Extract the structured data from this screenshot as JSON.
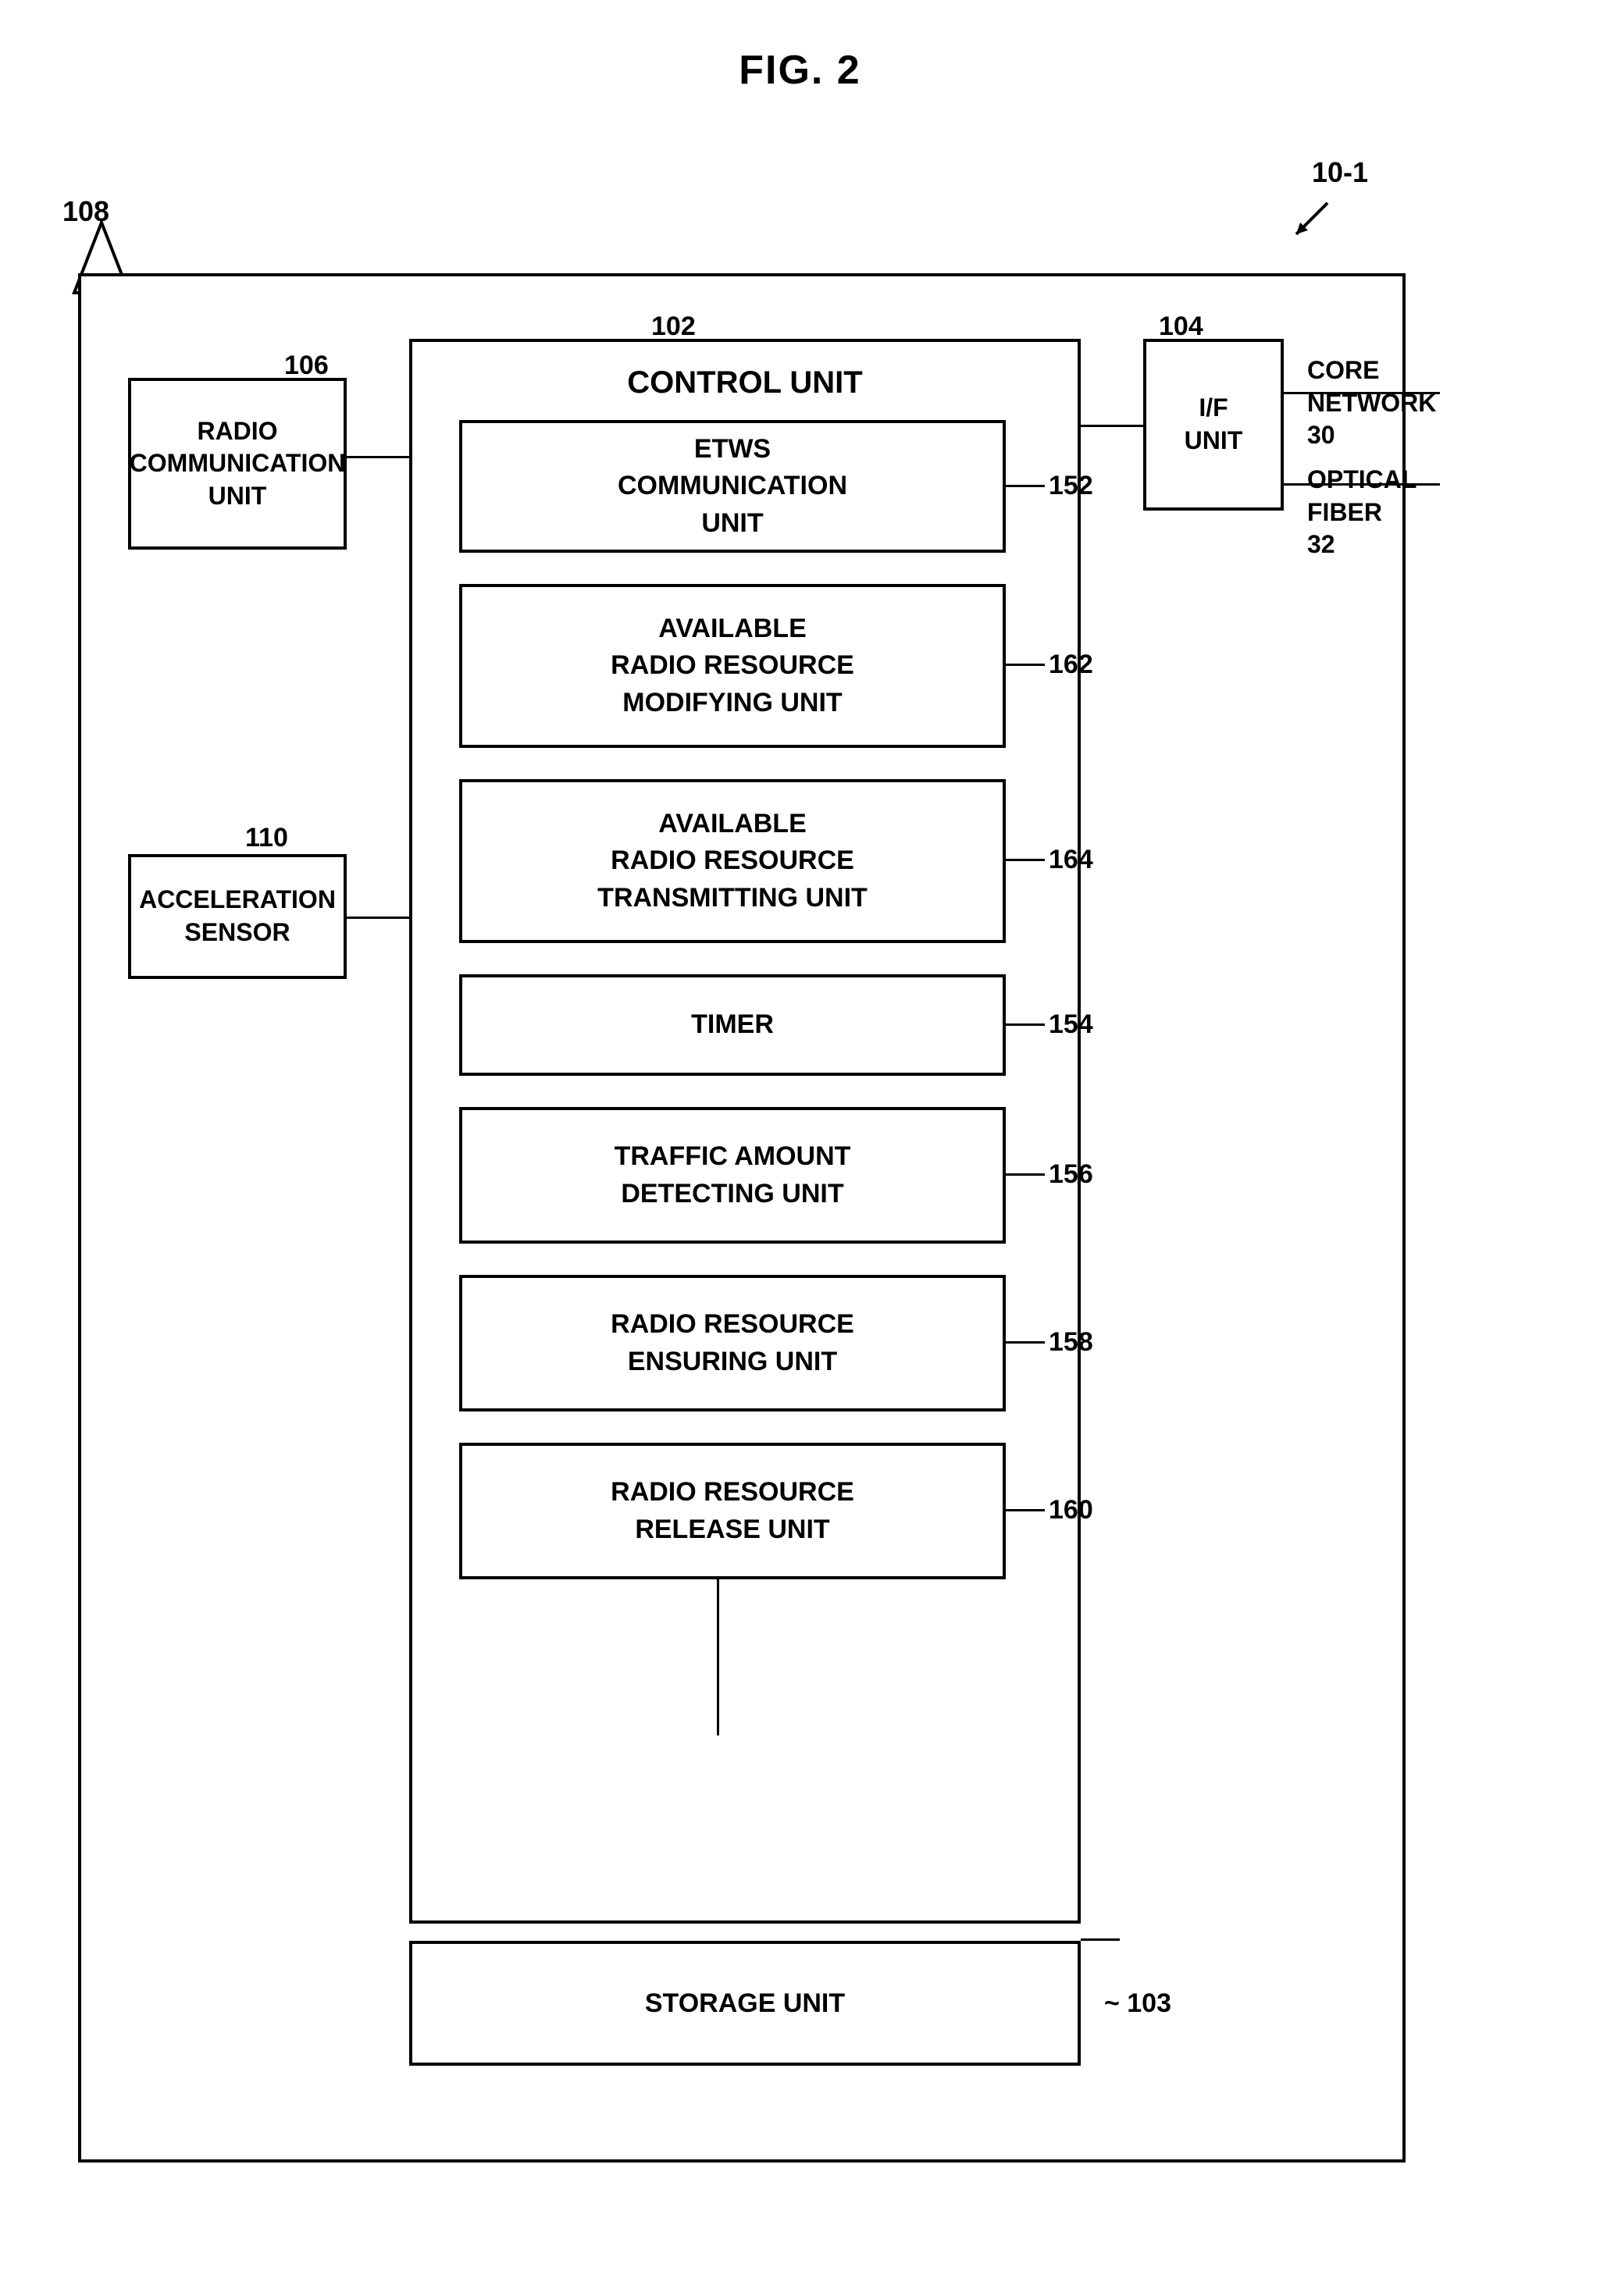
{
  "title": "FIG. 2",
  "labels": {
    "fig": "FIG. 2",
    "antenna_ref": "108",
    "system_ref": "10-1",
    "radio_comm": "RADIO\nCOMMUNICATION\nUNIT",
    "radio_comm_ref": "106",
    "accel_sensor": "ACCELERATION\nSENSOR",
    "accel_sensor_ref": "110",
    "control_unit": "CONTROL UNIT",
    "control_unit_ref": "102",
    "if_unit": "I/F\nUNIT",
    "if_unit_ref": "104",
    "core_network": "CORE\nNETWORK 30",
    "optical_fiber": "OPTICAL\nFIBER 32",
    "etws": "ETWS\nCOMMUNICATION\nUNIT",
    "etws_ref": "152",
    "avail_modifying": "AVAILABLE\nRADIO RESOURCE\nMODIFYING UNIT",
    "avail_modifying_ref": "162",
    "avail_transmitting": "AVAILABLE\nRADIO RESOURCE\nTRANSMITTING UNIT",
    "avail_transmitting_ref": "164",
    "timer": "TIMER",
    "timer_ref": "154",
    "traffic": "TRAFFIC AMOUNT\nDETECTING UNIT",
    "traffic_ref": "156",
    "radio_ensuring": "RADIO RESOURCE\nENSURING UNIT",
    "radio_ensuring_ref": "158",
    "radio_release": "RADIO RESOURCE\nRELEASE UNIT",
    "radio_release_ref": "160",
    "storage": "STORAGE UNIT",
    "storage_ref": "103"
  }
}
